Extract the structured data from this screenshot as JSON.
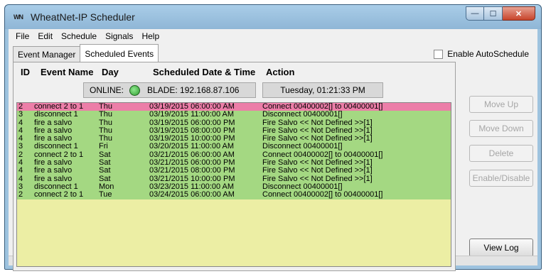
{
  "window": {
    "title": "WheatNet-IP Scheduler",
    "icon_text": "WN",
    "min_symbol": "—",
    "max_symbol": "☐",
    "close_symbol": "✕"
  },
  "menu": [
    "File",
    "Edit",
    "Schedule",
    "Signals",
    "Help"
  ],
  "tabs": [
    {
      "label": "Event Manager",
      "active": false
    },
    {
      "label": "Scheduled Events",
      "active": true
    }
  ],
  "autoschedule": {
    "label": "Enable AutoSchedule",
    "checked": false
  },
  "columns": {
    "id": "ID",
    "name": "Event Name",
    "day": "Day",
    "datetime": "Scheduled Date & Time",
    "action": "Action"
  },
  "status": {
    "online_label": "ONLINE:",
    "blade_label": "BLADE: 192.168.87.106",
    "led_color": "#2f9d2f",
    "clock": "Tuesday,  01:21:33 PM"
  },
  "events": [
    {
      "id": "2",
      "name": "connect 2 to 1",
      "day": "Thu",
      "datetime": "03/19/2015  06:00:00 AM",
      "action": "Connect 00400002[] to 00400001[]",
      "selected": true
    },
    {
      "id": "3",
      "name": "disconnect 1",
      "day": "Thu",
      "datetime": "03/19/2015  11:00:00 AM",
      "action": "Disconnect 00400001[]"
    },
    {
      "id": "4",
      "name": "fire a salvo",
      "day": "Thu",
      "datetime": "03/19/2015  06:00:00 PM",
      "action": "Fire Salvo << Not Defined >>[1]"
    },
    {
      "id": "4",
      "name": "fire a salvo",
      "day": "Thu",
      "datetime": "03/19/2015  08:00:00 PM",
      "action": "Fire Salvo << Not Defined >>[1]"
    },
    {
      "id": "4",
      "name": "fire a salvo",
      "day": "Thu",
      "datetime": "03/19/2015  10:00:00 PM",
      "action": "Fire Salvo << Not Defined >>[1]"
    },
    {
      "id": "3",
      "name": "disconnect 1",
      "day": "Fri",
      "datetime": "03/20/2015  11:00:00 AM",
      "action": "Disconnect 00400001[]"
    },
    {
      "id": "2",
      "name": "connect 2 to 1",
      "day": "Sat",
      "datetime": "03/21/2015  06:00:00 AM",
      "action": "Connect 00400002[] to 00400001[]"
    },
    {
      "id": "4",
      "name": "fire a salvo",
      "day": "Sat",
      "datetime": "03/21/2015  06:00:00 PM",
      "action": "Fire Salvo << Not Defined >>[1]"
    },
    {
      "id": "4",
      "name": "fire a salvo",
      "day": "Sat",
      "datetime": "03/21/2015  08:00:00 PM",
      "action": "Fire Salvo << Not Defined >>[1]"
    },
    {
      "id": "4",
      "name": "fire a salvo",
      "day": "Sat",
      "datetime": "03/21/2015  10:00:00 PM",
      "action": "Fire Salvo << Not Defined >>[1]"
    },
    {
      "id": "3",
      "name": "disconnect 1",
      "day": "Mon",
      "datetime": "03/23/2015  11:00:00 AM",
      "action": "Disconnect 00400001[]"
    },
    {
      "id": "2",
      "name": "connect 2 to 1",
      "day": "Tue",
      "datetime": "03/24/2015  06:00:00 AM",
      "action": "Connect 00400002[] to 00400001[]"
    }
  ],
  "colors": {
    "selected_row": "#ec7ea8",
    "active_row": "#a4d882",
    "list_background": "#eceea4"
  },
  "buttons": {
    "move_up": "Move Up",
    "move_down": "Move Down",
    "delete": "Delete",
    "enable_disable": "Enable/Disable",
    "view_log": "View Log"
  }
}
